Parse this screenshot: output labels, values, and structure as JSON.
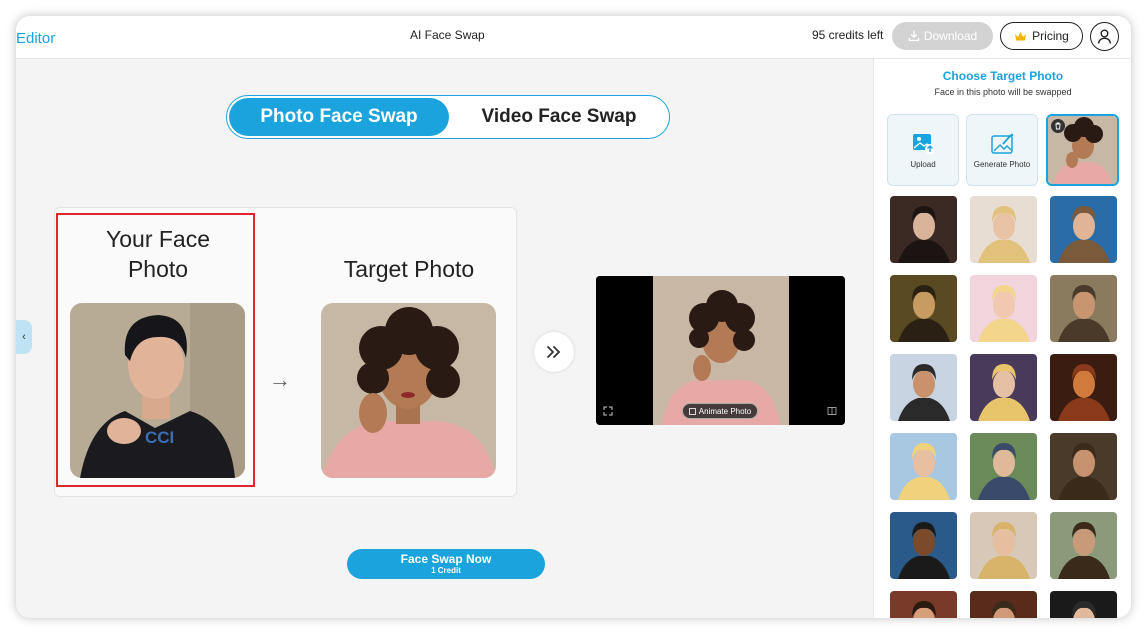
{
  "header": {
    "brand": "Editor",
    "title": "AI Face Swap",
    "credits": "95 credits left",
    "download_label": "Download",
    "pricing_label": "Pricing",
    "download_icon": "download-icon",
    "pricing_icon": "crown-icon",
    "profile_icon": "user-icon"
  },
  "mode_tabs": {
    "photo": "Photo Face Swap",
    "video": "Video Face Swap",
    "active": "photo"
  },
  "swap_card": {
    "face_title_line1": "Your Face",
    "face_title_line2": "Photo",
    "target_title": "Target Photo"
  },
  "result": {
    "animate_label": "Animate Photo"
  },
  "action": {
    "button_label": "Face Swap Now",
    "cost_label": "1 Credit"
  },
  "panel": {
    "title": "Choose Target Photo",
    "subtitle": "Face in this photo will be swapped",
    "upload_label": "Upload",
    "generate_label": "Generate Photo",
    "thumbnail_count": 18
  },
  "colors": {
    "accent": "#1aa3dc",
    "highlight_border": "#e0262c",
    "download_disabled": "#d3d3d3"
  }
}
